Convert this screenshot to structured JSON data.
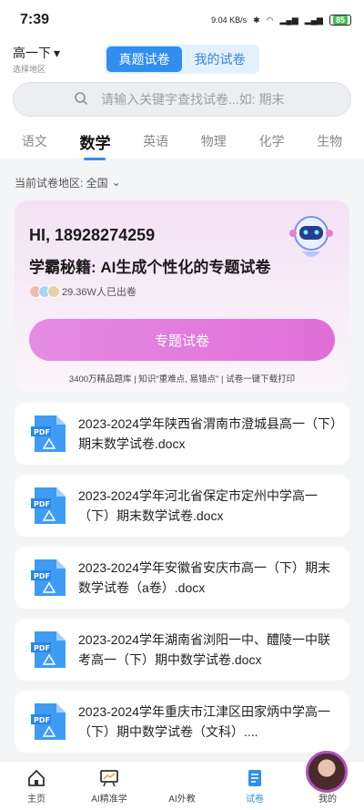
{
  "status": {
    "time": "7:39",
    "net": "9.04 KB/s",
    "battery": "85"
  },
  "header": {
    "grade": "高一下",
    "region_hint": "选择地区",
    "tabs": [
      "真题试卷",
      "我的试卷"
    ]
  },
  "search": {
    "placeholder": "请输入关键字查找试卷...如: 期末"
  },
  "subjects": [
    "语文",
    "数学",
    "英语",
    "物理",
    "化学",
    "生物"
  ],
  "area": {
    "label": "当前试卷地区: 全国"
  },
  "promo": {
    "greeting": "HI, 18928274259",
    "slogan": "学霸秘籍: AI生成个性化的专题试卷",
    "users": "29.36W人已出卷",
    "button": "专题试卷",
    "features": "3400万精品题库 | 知识\"重难点, 易错点\" | 试卷一键下载打印"
  },
  "papers": [
    "2023-2024学年陕西省渭南市澄城县高一（下）期末数学试卷.docx",
    "2023-2024学年河北省保定市定州中学高一（下）期末数学试卷.docx",
    "2023-2024学年安徽省安庆市高一（下）期末数学试卷（a卷）.docx",
    "2023-2024学年湖南省浏阳一中、醴陵一中联考高一（下）期中数学试卷.docx",
    "2023-2024学年重庆市江津区田家炳中学高一（下）期中数学试卷（文科）...."
  ],
  "tabbar": [
    "主页",
    "AI精准学",
    "AI外教",
    "试卷",
    "我的"
  ],
  "colors": {
    "accent": "#2f8ef0",
    "promo_button": "#e06ed8"
  }
}
